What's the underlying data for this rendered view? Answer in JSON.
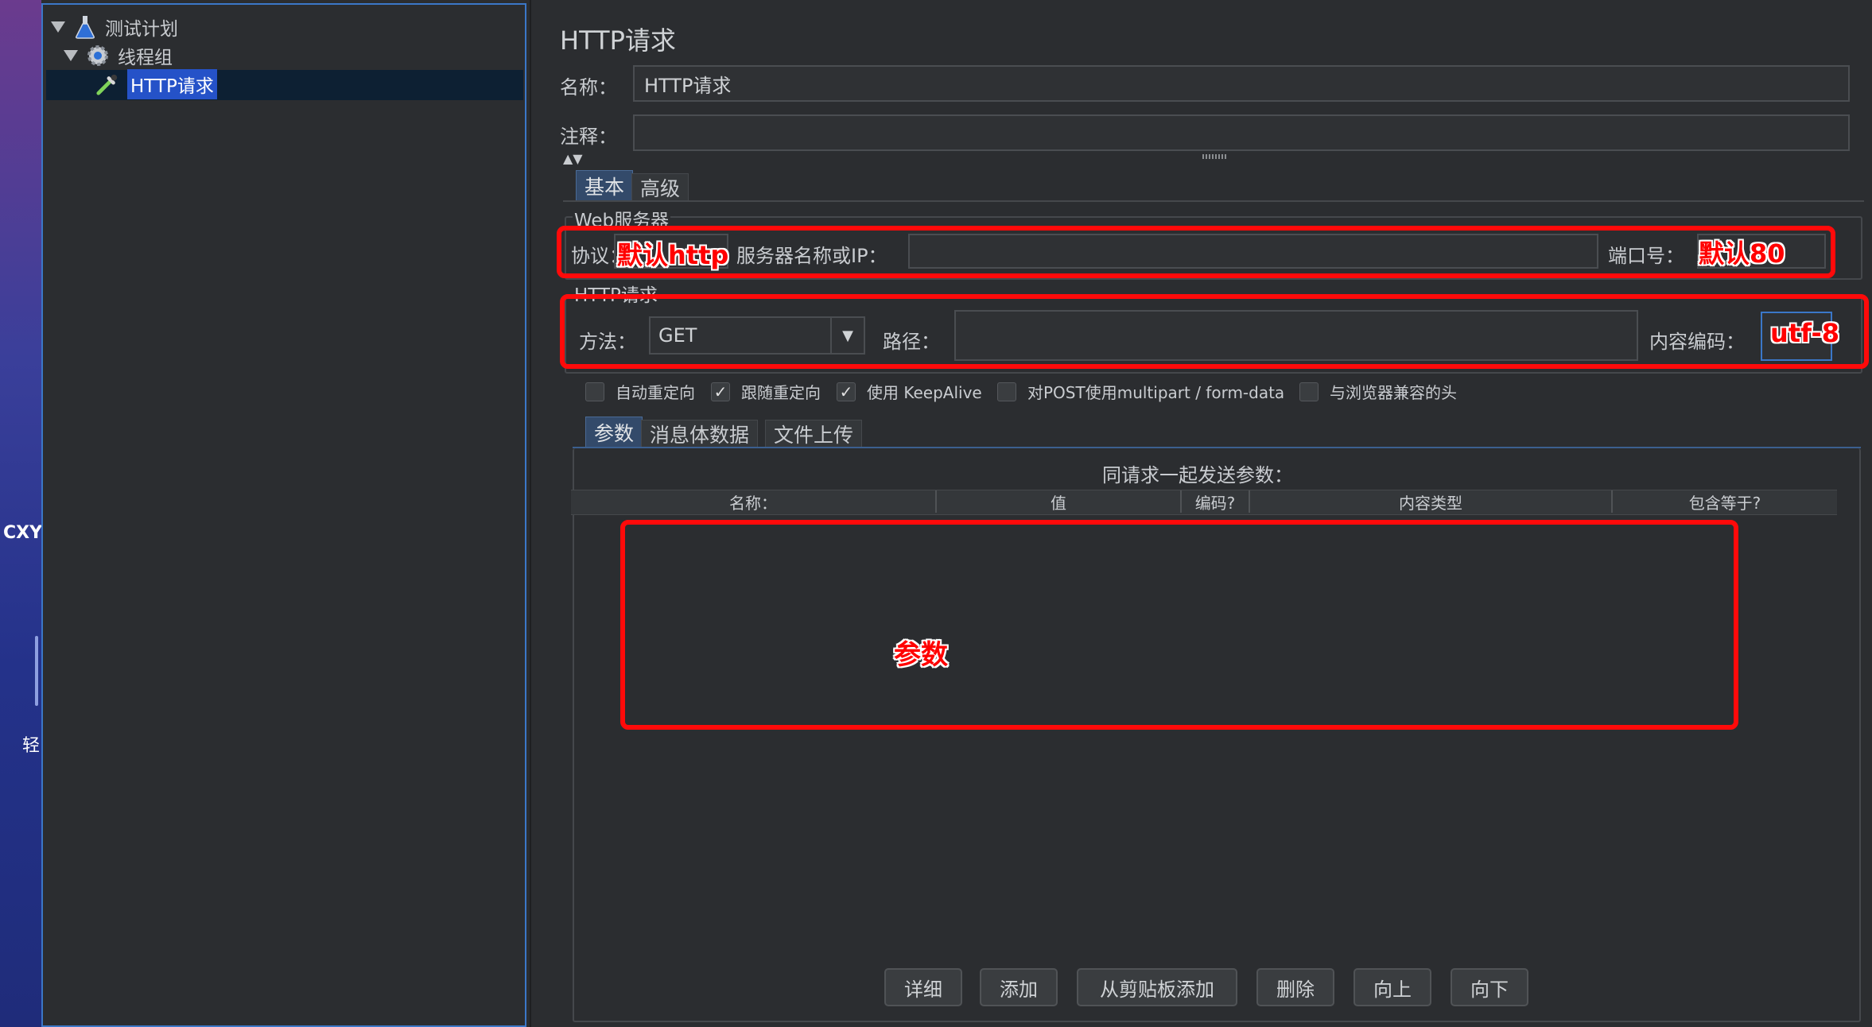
{
  "desktop": {
    "text1": "CXY",
    "text2": "轻"
  },
  "tree": {
    "plan": "测试计划",
    "thread_group": "线程组",
    "http_request": "HTTP请求"
  },
  "panel": {
    "title": "HTTP请求",
    "name_label": "名称：",
    "name_value": "HTTP请求",
    "comment_label": "注释：",
    "comment_value": ""
  },
  "tabs": {
    "basic": "基本",
    "advanced": "高级"
  },
  "web_server": {
    "legend": "Web服务器",
    "protocol_label": "协议：",
    "server_label": "服务器名称或IP：",
    "server_value": "",
    "port_label": "端口号："
  },
  "http_req": {
    "legend": "HTTP请求",
    "method_label": "方法：",
    "method_value": "GET",
    "path_label": "路径：",
    "path_value": "",
    "encoding_label": "内容编码："
  },
  "checkboxes": [
    {
      "label": "自动重定向",
      "checked": false
    },
    {
      "label": "跟随重定向",
      "checked": true
    },
    {
      "label": "使用 KeepAlive",
      "checked": true
    },
    {
      "label": "对POST使用multipart / form-data",
      "checked": false
    },
    {
      "label": "与浏览器兼容的头",
      "checked": false
    }
  ],
  "subtabs": {
    "params": "参数",
    "body": "消息体数据",
    "files": "文件上传"
  },
  "params_table": {
    "caption": "同请求一起发送参数：",
    "headers": [
      "名称：",
      "值",
      "编码?",
      "内容类型",
      "包含等于?"
    ]
  },
  "buttons": {
    "detail": "详细",
    "add": "添加",
    "add_clipboard": "从剪贴板添加",
    "delete": "删除",
    "up": "向上",
    "down": "向下"
  },
  "annotations": {
    "protocol": "默认http",
    "port": "默认80",
    "encoding": "utf-8",
    "params": "参数"
  },
  "colors": {
    "annotation": "#ff0000",
    "selection": "#2552c8",
    "panel_bg": "#2b2d30"
  }
}
